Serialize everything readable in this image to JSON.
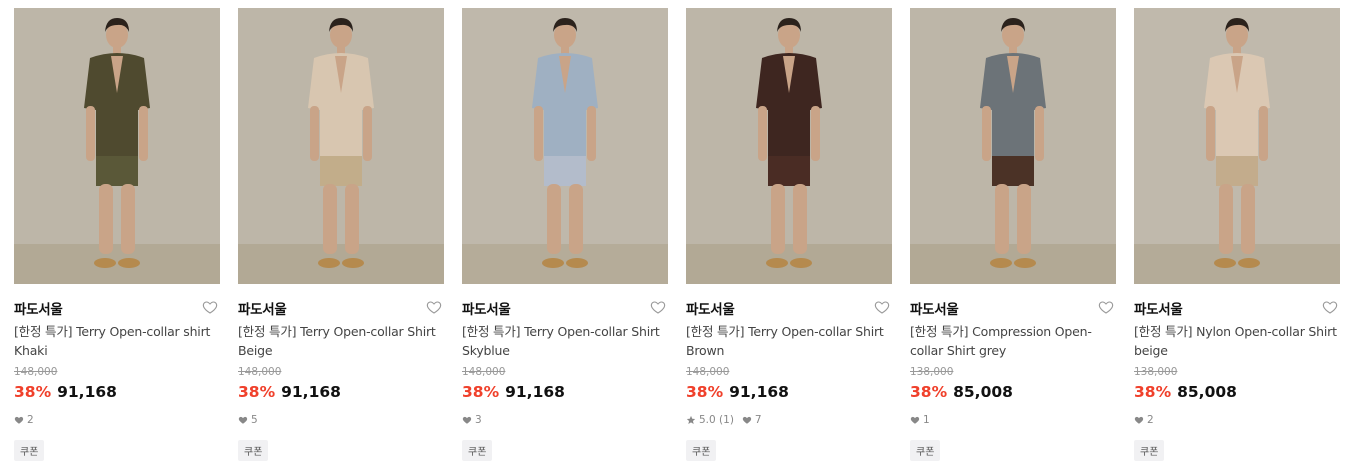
{
  "products": [
    {
      "brand": "파도서울",
      "name": "[한정 특가] Terry Open-collar shirt Khaki",
      "original_price": "148,000",
      "discount": "38%",
      "price": "91,168",
      "likes": "2",
      "rating": null,
      "coupon": "쿠폰",
      "shirt_color": "#4f4a2f",
      "shorts_color": "#5a5838",
      "wall_color": "#bdb6a8",
      "floor_color": "#b2a995"
    },
    {
      "brand": "파도서울",
      "name": "[한정 특가] Terry Open-collar Shirt Beige",
      "original_price": "148,000",
      "discount": "38%",
      "price": "91,168",
      "likes": "5",
      "rating": null,
      "coupon": "쿠폰",
      "shirt_color": "#d8c6b0",
      "shorts_color": "#c2ad8a",
      "wall_color": "#bdb6a8",
      "floor_color": "#b2a995"
    },
    {
      "brand": "파도서울",
      "name": "[한정 특가] Terry Open-collar Shirt Skyblue",
      "original_price": "148,000",
      "discount": "38%",
      "price": "91,168",
      "likes": "3",
      "rating": null,
      "coupon": "쿠폰",
      "shirt_color": "#9fb0c2",
      "shorts_color": "#b3bccb",
      "wall_color": "#bfb8ab",
      "floor_color": "#b5ac99"
    },
    {
      "brand": "파도서울",
      "name": "[한정 특가] Terry Open-collar Shirt Brown",
      "original_price": "148,000",
      "discount": "38%",
      "price": "91,168",
      "likes": "7",
      "rating": "5.0 (1)",
      "coupon": "쿠폰",
      "shirt_color": "#3e2620",
      "shorts_color": "#4a2c24",
      "wall_color": "#bdb6a8",
      "floor_color": "#b2a995"
    },
    {
      "brand": "파도서울",
      "name": "[한정 특가] Compression Open-collar Shirt grey",
      "original_price": "138,000",
      "discount": "38%",
      "price": "85,008",
      "likes": "1",
      "rating": null,
      "coupon": "쿠폰",
      "shirt_color": "#6c7378",
      "shorts_color": "#4b3226",
      "wall_color": "#bdb6a8",
      "floor_color": "#b2a995"
    },
    {
      "brand": "파도서울",
      "name": "[한정 특가] Nylon Open-collar Shirt beige",
      "original_price": "138,000",
      "discount": "38%",
      "price": "85,008",
      "likes": "2",
      "rating": null,
      "coupon": "쿠폰",
      "shirt_color": "#dbc8b3",
      "shorts_color": "#c3ac8c",
      "wall_color": "#c0b9ac",
      "floor_color": "#b4ab98"
    }
  ],
  "colors": {
    "discount": "#f0402b",
    "muted": "#999999",
    "coupon_bg": "#f1f1f3"
  }
}
